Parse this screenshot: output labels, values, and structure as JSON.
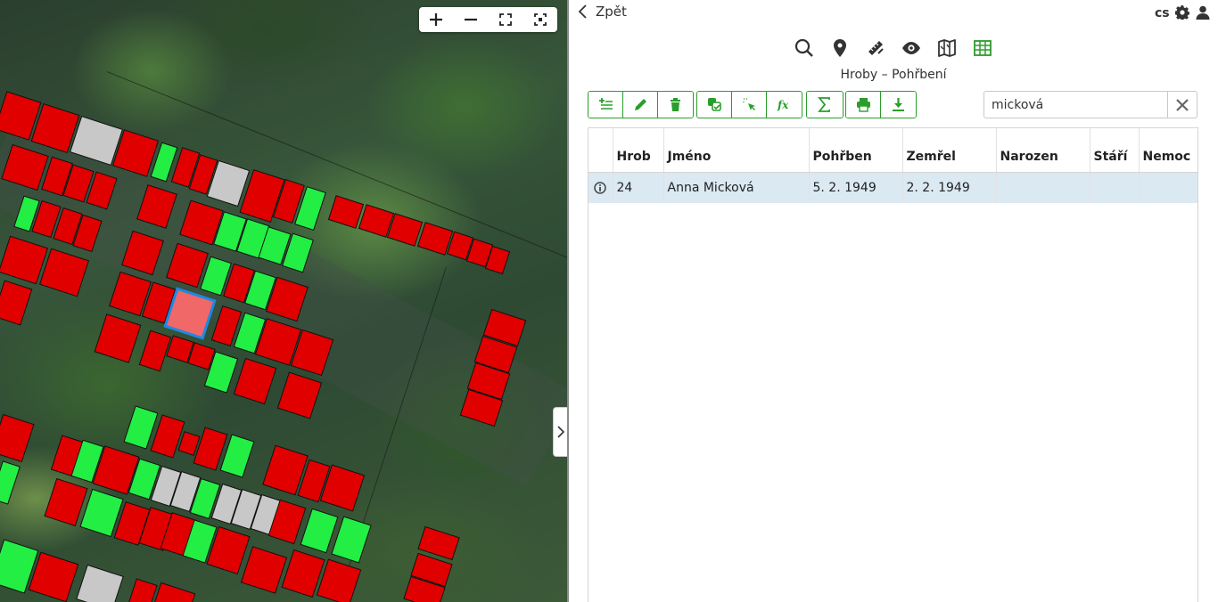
{
  "map": {
    "toolbar": [
      {
        "icon": "zoom-in-icon"
      },
      {
        "icon": "zoom-out-icon"
      },
      {
        "icon": "fullscreen-icon"
      },
      {
        "icon": "zoom-to-extent-icon"
      }
    ],
    "colors": {
      "occupied": "#e00000",
      "free": "#22ee44",
      "unknown": "#c8c8c8",
      "selected_fill": "#f06868",
      "selected_border": "#1e88e5"
    }
  },
  "panel": {
    "back_label": "Zpět",
    "lang": "cs",
    "tabs": [
      "search-icon",
      "location-pin-icon",
      "measure-icon",
      "eye-icon",
      "map-icon",
      "table-icon"
    ],
    "subtitle": "Hroby – Pohřbení",
    "accent": "#2a9d2a",
    "search": {
      "value": "micková"
    },
    "table": {
      "headers": [
        "",
        "Hrob",
        "Jméno",
        "Pohřben",
        "Zemřel",
        "Narozen",
        "Stáří",
        "Nemoc"
      ],
      "rows": [
        {
          "hrob": "24",
          "jmeno": "Anna Micková",
          "pohrben": "5. 2. 1949",
          "zemrel": "2. 2. 1949",
          "narozen": "",
          "stari": "",
          "nemoc": ""
        }
      ]
    }
  }
}
